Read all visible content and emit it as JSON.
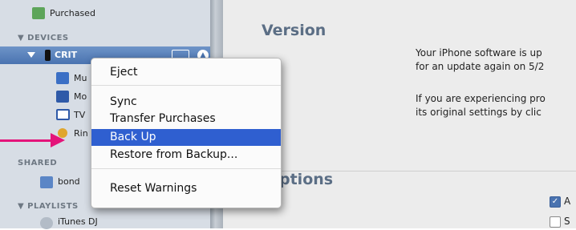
{
  "sidebar": {
    "purchased_label": "Purchased",
    "devices_header": "▼ DEVICES",
    "device_name": "CRIT",
    "items": [
      {
        "label": "Mu"
      },
      {
        "label": "Mo"
      },
      {
        "label": "TV"
      },
      {
        "label": "Rin"
      }
    ],
    "shared_header": "SHARED",
    "shared_item": "bond",
    "playlists_header": "▼ PLAYLISTS",
    "playlist_item": "iTunes DJ"
  },
  "main": {
    "version_title": "Version",
    "version_line1": "Your iPhone software is up",
    "version_line2": "for an update again on 5/2",
    "restore_line1": "If you are experiencing pro",
    "restore_line2": "its original settings by clic",
    "options_title": "ptions",
    "opt1_label": "A",
    "opt2_label": "S"
  },
  "context_menu": {
    "eject": "Eject",
    "sync": "Sync",
    "transfer": "Transfer Purchases",
    "backup": "Back Up",
    "restore": "Restore from Backup...",
    "reset": "Reset Warnings"
  },
  "colors": {
    "highlight": "#2f5fd0",
    "annotation_arrow": "#e4147a",
    "sidebar_bg": "#d7dde5",
    "selection": "#4a73b0"
  }
}
